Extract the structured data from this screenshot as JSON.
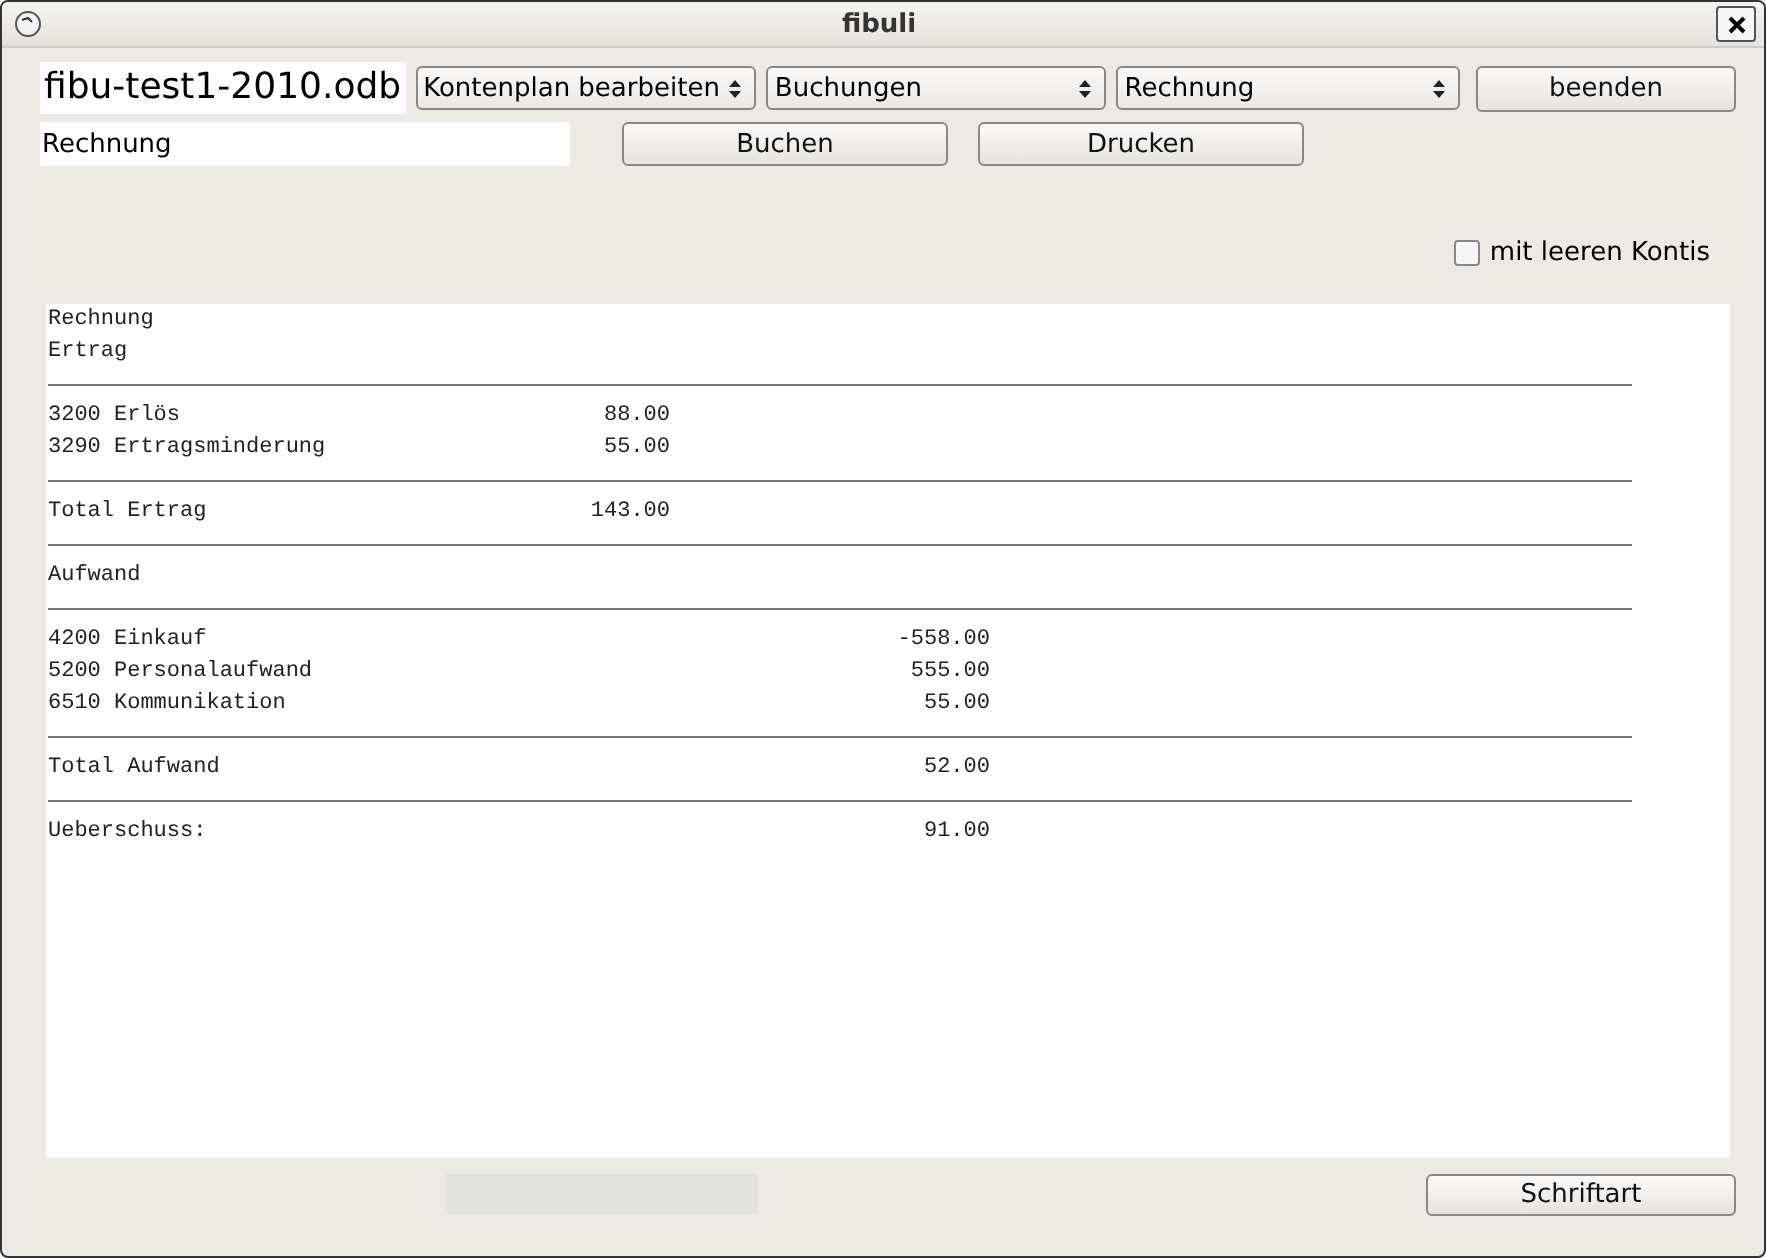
{
  "window": {
    "title": "fibuli"
  },
  "toolbar": {
    "file_name": "fibu-test1-2010.odb",
    "dropdowns": [
      {
        "value": "Kontenplan bearbeiten"
      },
      {
        "value": "Buchungen"
      },
      {
        "value": "Rechnung"
      }
    ],
    "quit_button": "beenden"
  },
  "row2": {
    "field_value": "Rechnung",
    "buttons": [
      "Buchen",
      "Drucken"
    ]
  },
  "checkbox": {
    "label": "mit leeren Kontis",
    "checked": false
  },
  "report": [
    {
      "kind": "text",
      "label": "Rechnung"
    },
    {
      "kind": "text",
      "label": "Ertrag"
    },
    {
      "kind": "rule"
    },
    {
      "kind": "row",
      "label": "3200 Erlös",
      "column_1": "88.00"
    },
    {
      "kind": "row",
      "label": "3290 Ertragsminderung",
      "column_1": "55.00"
    },
    {
      "kind": "rule"
    },
    {
      "kind": "row",
      "label": "Total Ertrag",
      "column_1": "143.00"
    },
    {
      "kind": "rule"
    },
    {
      "kind": "text",
      "label": "Aufwand"
    },
    {
      "kind": "rule"
    },
    {
      "kind": "row",
      "label": "4200 Einkauf",
      "column_2": "-558.00"
    },
    {
      "kind": "row",
      "label": "5200 Personalaufwand",
      "column_2": "555.00"
    },
    {
      "kind": "row",
      "label": "6510 Kommunikation",
      "column_2": "55.00"
    },
    {
      "kind": "rule"
    },
    {
      "kind": "row",
      "label": "Total Aufwand",
      "column_2": "52.00"
    },
    {
      "kind": "rule"
    },
    {
      "kind": "row",
      "label": "Ueberschuss:",
      "column_2": "91.00"
    }
  ],
  "font_button": "Schriftart"
}
